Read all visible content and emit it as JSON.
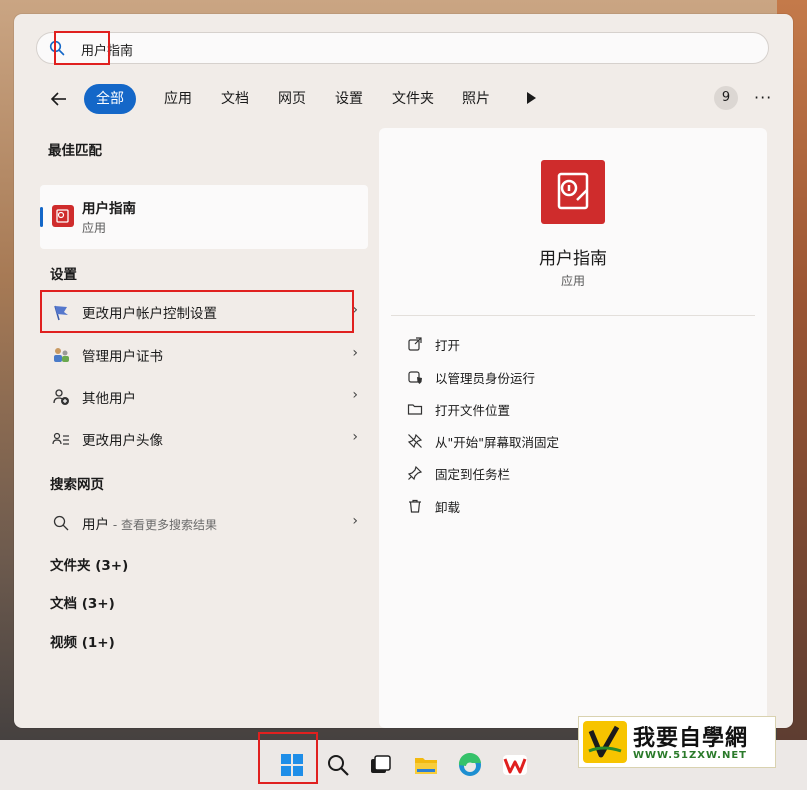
{
  "search": {
    "value": "用户指南"
  },
  "filters": {
    "tabs": [
      "全部",
      "应用",
      "文档",
      "网页",
      "设置",
      "文件夹",
      "照片"
    ],
    "count": "9",
    "more": "···"
  },
  "best_match": {
    "title": "最佳匹配",
    "name": "用户指南",
    "type": "应用"
  },
  "settings": {
    "title": "设置",
    "items": [
      {
        "label": "更改用户帐户控制设置"
      },
      {
        "label": "管理用户证书"
      },
      {
        "label": "其他用户"
      },
      {
        "label": "更改用户头像"
      }
    ]
  },
  "web": {
    "title": "搜索网页",
    "query": "用户",
    "hint": " - 查看更多搜索结果"
  },
  "groups": [
    "文件夹 (3+)",
    "文档 (3+)",
    "视频 (1+)"
  ],
  "detail": {
    "name": "用户指南",
    "type": "应用",
    "actions": [
      "打开",
      "以管理员身份运行",
      "打开文件位置",
      "从\"开始\"屏幕取消固定",
      "固定到任务栏",
      "卸载"
    ]
  },
  "chevron": "›",
  "watermark": {
    "name": "我要自學網",
    "url": "WWW.51ZXW.NET"
  },
  "colors": {
    "accent": "#1467c8",
    "app_red": "#cf2c2c",
    "highlight": "#e0201f"
  }
}
